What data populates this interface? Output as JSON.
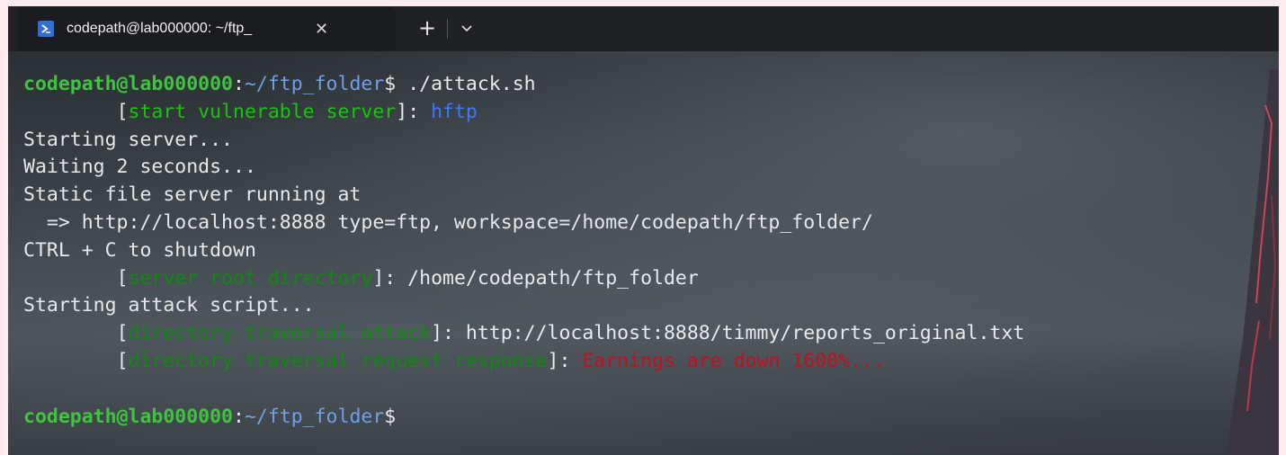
{
  "tab": {
    "title": "codepath@lab000000: ~/ftp_",
    "close": "✕",
    "new_tab": "+",
    "icon": "powershell-icon"
  },
  "terminal": {
    "prompt_user": "codepath@lab000000",
    "prompt_sep": ":",
    "prompt_path": "~/ftp_folder",
    "prompt_dollar": "$",
    "command": " ./attack.sh",
    "line2_indent": "        ",
    "line2_open": "[",
    "line2_label": "start vulnerable server",
    "line2_close": "]",
    "line2_colon": ": ",
    "line2_value": "hftp",
    "line3": "Starting server...",
    "line4": "Waiting 2 seconds...",
    "line5": "Static file server running at",
    "line6": "  => http://localhost:8888 type=ftp, workspace=/home/codepath/ftp_folder/",
    "line7": "CTRL + C to shutdown",
    "line8_indent": "        ",
    "line8_open": "[",
    "line8_label": "server root directory",
    "line8_close": "]",
    "line8_rest": ": /home/codepath/ftp_folder",
    "line9": "Starting attack script...",
    "line10_indent": "        ",
    "line10_open": "[",
    "line10_label": "directory traversal attack",
    "line10_close": "]",
    "line10_rest": ": http://localhost:8888/timmy/reports_original.txt",
    "line11_indent": "        ",
    "line11_open": "[",
    "line11_label": "directory traversal request response",
    "line11_close": "]",
    "line11_colon": ": ",
    "line11_value": "Earnings are down 1600%...",
    "prompt2_user": "codepath@lab000000",
    "prompt2_sep": ":",
    "prompt2_path": "~/ftp_folder",
    "prompt2_dollar": "$"
  }
}
